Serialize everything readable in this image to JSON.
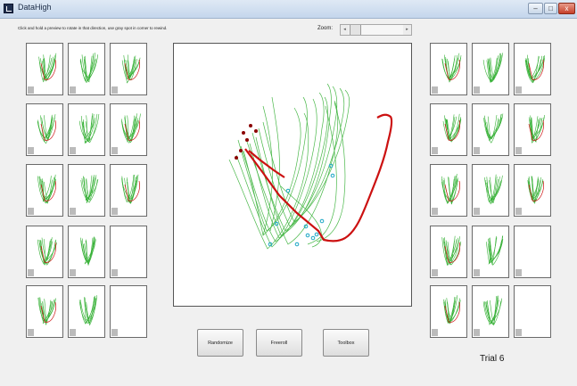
{
  "window": {
    "title": "DataHigh"
  },
  "hint_text": "Click and hold a preview to rotate in that direction, use gray spot in corner to rewind.",
  "zoom": {
    "label": "Zoom:",
    "left_arrow": "◂",
    "right_arrow": "▸"
  },
  "window_controls": {
    "minimize": "–",
    "maximize": "□",
    "close": "x"
  },
  "buttons": {
    "randomize": "Randomize",
    "freeroll": "Freeroll",
    "toolbox": "Toolbox"
  },
  "trial_label": "Trial 6",
  "colors": {
    "trajectory": "#35b035",
    "highlight": "#cc1111",
    "start_marker": "#8b0000",
    "end_marker": "#1aa6c4"
  },
  "previews": {
    "left": [
      {
        "row": 1,
        "col": 1,
        "has_plot": true
      },
      {
        "row": 1,
        "col": 2,
        "has_plot": true
      },
      {
        "row": 1,
        "col": 3,
        "has_plot": true
      },
      {
        "row": 2,
        "col": 1,
        "has_plot": true
      },
      {
        "row": 2,
        "col": 2,
        "has_plot": true
      },
      {
        "row": 2,
        "col": 3,
        "has_plot": true
      },
      {
        "row": 3,
        "col": 1,
        "has_plot": true
      },
      {
        "row": 3,
        "col": 2,
        "has_plot": true
      },
      {
        "row": 3,
        "col": 3,
        "has_plot": true
      },
      {
        "row": 4,
        "col": 1,
        "has_plot": true
      },
      {
        "row": 4,
        "col": 2,
        "has_plot": true
      },
      {
        "row": 4,
        "col": 3,
        "has_plot": false
      },
      {
        "row": 5,
        "col": 1,
        "has_plot": true
      },
      {
        "row": 5,
        "col": 2,
        "has_plot": true
      },
      {
        "row": 5,
        "col": 3,
        "has_plot": false
      }
    ],
    "right": [
      {
        "row": 1,
        "col": 1,
        "has_plot": true
      },
      {
        "row": 1,
        "col": 2,
        "has_plot": true
      },
      {
        "row": 1,
        "col": 3,
        "has_plot": true
      },
      {
        "row": 2,
        "col": 1,
        "has_plot": true
      },
      {
        "row": 2,
        "col": 2,
        "has_plot": true
      },
      {
        "row": 2,
        "col": 3,
        "has_plot": true
      },
      {
        "row": 3,
        "col": 1,
        "has_plot": true
      },
      {
        "row": 3,
        "col": 2,
        "has_plot": true
      },
      {
        "row": 3,
        "col": 3,
        "has_plot": true
      },
      {
        "row": 4,
        "col": 1,
        "has_plot": true
      },
      {
        "row": 4,
        "col": 2,
        "has_plot": true
      },
      {
        "row": 4,
        "col": 3,
        "has_plot": false
      },
      {
        "row": 5,
        "col": 1,
        "has_plot": true
      },
      {
        "row": 5,
        "col": 2,
        "has_plot": true
      },
      {
        "row": 5,
        "col": 3,
        "has_plot": false
      }
    ]
  }
}
